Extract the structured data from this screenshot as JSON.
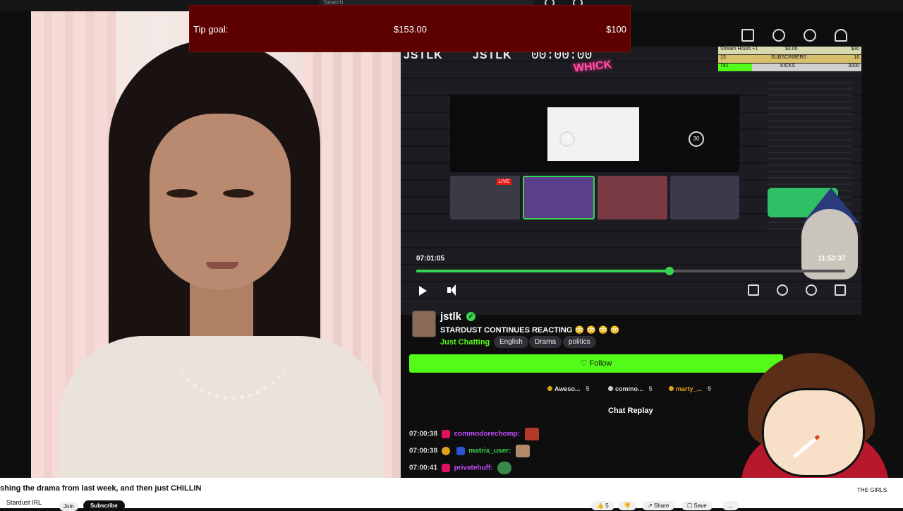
{
  "topbar": {
    "search_placeholder": "Search"
  },
  "tip_goal": {
    "label": "Tip goal:",
    "current": "$153.00",
    "target": "$100"
  },
  "stream_overlay": {
    "logo1": "JSTLK",
    "logo2": "JSTLK",
    "timer": "00:00:00",
    "neon_sign": "WHICK",
    "live_badge": "LIVE",
    "skip_back": "10",
    "skip_forward": "30",
    "stats": {
      "row1_label": "Stream Hours +1",
      "row1_value": "$3.00",
      "row1_goal": "$30",
      "row2_count": "13",
      "row2_label": "SUBSCRIBERS",
      "row2_goal": "16",
      "row3_count": "741",
      "row3_label": "KICKS",
      "row3_goal": "3000"
    }
  },
  "player": {
    "elapsed": "07:01:05",
    "duration": "11:52:37",
    "progress": 0.59
  },
  "channel": {
    "name": "jstlk",
    "title": "STARDUST CONTINUES REACTING 😳 😳 😳 😳",
    "category": "Just Chatting",
    "tags": [
      "English",
      "Drama",
      "politics"
    ],
    "follow_label": "Follow"
  },
  "gifters": [
    {
      "name": "Aweso...",
      "count": "5"
    },
    {
      "name": "commo...",
      "count": "5"
    },
    {
      "name": "marty_...",
      "count": "5"
    }
  ],
  "chat": {
    "header": "Chat Replay",
    "messages": [
      {
        "time": "07:00:38",
        "user": "commodorechomp:"
      },
      {
        "time": "07:00:38",
        "user": "matrix_user:"
      },
      {
        "time": "07:00:41",
        "user": "privatehuff:"
      }
    ]
  },
  "youtube": {
    "title": "shing the drama from last week, and then just CHILLIN",
    "channel": "Stardust IRL",
    "join": "Join",
    "subscribe": "Subscribe",
    "likes": "5",
    "share": "Share",
    "save": "Save",
    "more": "...",
    "right_label": "THE GIRLS"
  },
  "colors": {
    "kick_green": "#53fc18",
    "tip_red": "#5c0000",
    "subscribe_black": "#0f0f0f"
  }
}
